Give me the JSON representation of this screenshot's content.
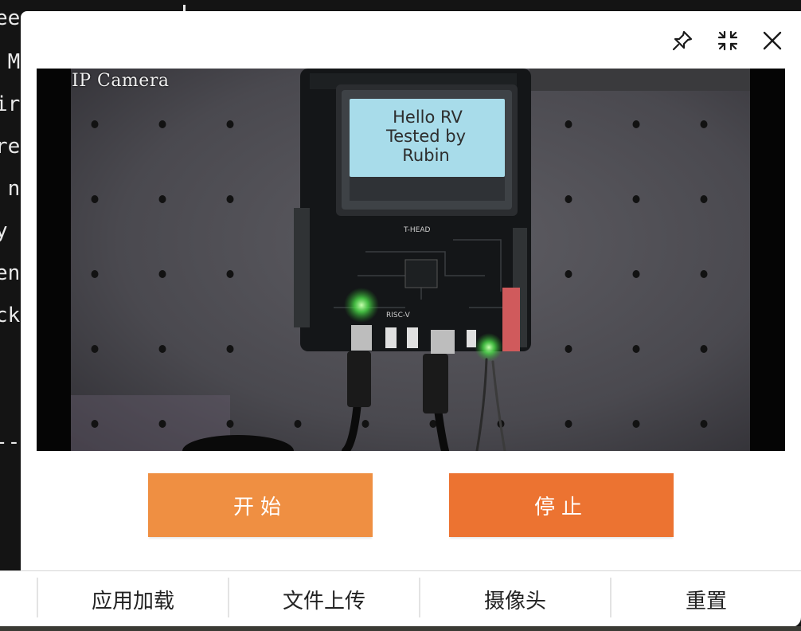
{
  "terminal": {
    "lines": [
      "ee",
      " M",
      "ir",
      "re",
      " n",
      "y",
      "en",
      "ck",
      "--"
    ]
  },
  "window_controls": {
    "pin_icon": "pin-icon",
    "fullscreen_icon": "fullscreen-icon",
    "close_icon": "close-icon"
  },
  "camera": {
    "overlay_label": "IP Camera",
    "lcd_line1": "Hello RV",
    "lcd_line2": "Tested by",
    "lcd_line3": "Rubin",
    "board_logo": "T-HEAD",
    "board_riscv_logo": "RISC-V"
  },
  "actions": {
    "start_label": "开始",
    "stop_label": "停止"
  },
  "tabs": [
    "应用加载",
    "文件上传",
    "摄像头",
    "重置"
  ],
  "colors": {
    "start": "#ef8f42",
    "stop": "#ec7331"
  }
}
